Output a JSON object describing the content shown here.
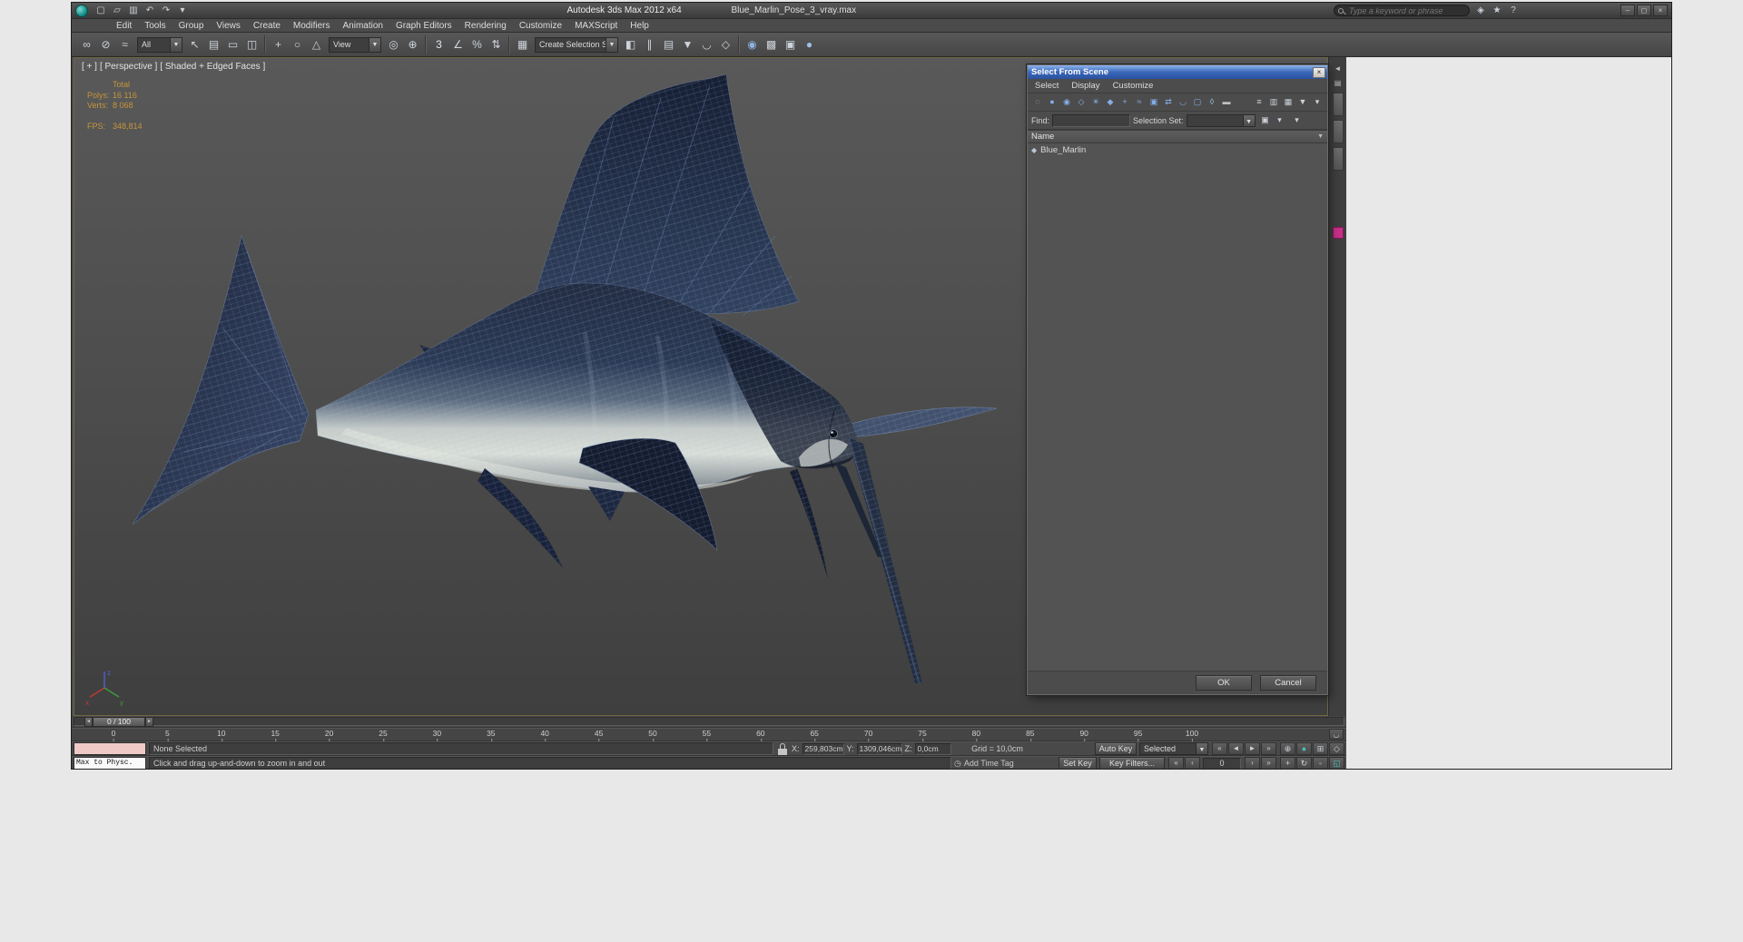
{
  "colors": {
    "accent_teal": "#45c0b5",
    "stats_amber": "#c6953b",
    "dialog_title_blue": "#3a67b8",
    "listener_pink": "#efc9c6",
    "magenta_chip": "#ca2f88",
    "marlin_navy": "#222c42",
    "marlin_belly": "#dadfd9"
  },
  "window": {
    "app_title": "Autodesk 3ds Max 2012 x64",
    "doc_title": "Blue_Marlin_Pose_3_vray.max",
    "search_placeholder": "Type a keyword or phrase",
    "quick_access": [
      {
        "name": "new-scene-icon",
        "glyph": "▢"
      },
      {
        "name": "open-file-icon",
        "glyph": "▱"
      },
      {
        "name": "save-file-icon",
        "glyph": "▥"
      },
      {
        "name": "undo-icon",
        "glyph": "↶"
      },
      {
        "name": "redo-icon",
        "glyph": "↷"
      },
      {
        "name": "project-folder-icon",
        "glyph": "▾"
      }
    ],
    "title_right_icons": [
      {
        "name": "communication-center-icon",
        "glyph": "◈"
      },
      {
        "name": "favorites-icon",
        "glyph": "★"
      },
      {
        "name": "help-icon",
        "glyph": "?"
      }
    ],
    "window_controls": [
      {
        "name": "minimize-button",
        "glyph": "–"
      },
      {
        "name": "restore-button",
        "glyph": "◻"
      },
      {
        "name": "close-button",
        "glyph": "×"
      }
    ]
  },
  "menus": [
    "Edit",
    "Tools",
    "Group",
    "Views",
    "Create",
    "Modifiers",
    "Animation",
    "Graph Editors",
    "Rendering",
    "Customize",
    "MAXScript",
    "Help"
  ],
  "toolbar": {
    "filter_value": "All",
    "coord_value": "View",
    "selection_set_value": "Create Selection Set",
    "group1": [
      {
        "name": "select-and-link-icon",
        "glyph": "∞"
      },
      {
        "name": "unlink-selection-icon",
        "glyph": "⊘"
      },
      {
        "name": "bind-to-space-warp-icon",
        "glyph": "≈"
      }
    ],
    "group2": [
      {
        "name": "select-object-icon",
        "glyph": "↖"
      },
      {
        "name": "select-by-name-icon",
        "glyph": "▤"
      },
      {
        "name": "rectangular-selection-region-icon",
        "glyph": "▭"
      },
      {
        "name": "window-crossing-icon",
        "glyph": "◫"
      },
      {
        "sep": true
      },
      {
        "name": "select-and-move-icon",
        "glyph": "+"
      },
      {
        "name": "select-and-rotate-icon",
        "glyph": "○"
      },
      {
        "name": "select-and-scale-icon",
        "glyph": "△"
      }
    ],
    "group3": [
      {
        "name": "use-pivot-point-center-icon",
        "glyph": "◎"
      },
      {
        "name": "select-and-manipulate-icon",
        "glyph": "⊕"
      },
      {
        "sep": true
      },
      {
        "name": "snaps-toggle-icon",
        "glyph": "3",
        "color": "#e2e8ef"
      },
      {
        "name": "angle-snap-icon",
        "glyph": "∠"
      },
      {
        "name": "percent-snap-icon",
        "glyph": "%"
      },
      {
        "name": "spinner-snap-icon",
        "glyph": "⇅"
      },
      {
        "sep": true
      },
      {
        "name": "edit-named-selection-sets-icon",
        "glyph": "▦"
      }
    ],
    "group4": [
      {
        "name": "mirror-icon",
        "glyph": "◧"
      },
      {
        "name": "align-icon",
        "glyph": "∥"
      },
      {
        "name": "layer-manager-icon",
        "glyph": "▤"
      },
      {
        "name": "graphite-modeling-icon",
        "glyph": "▼"
      },
      {
        "name": "curve-editor-icon",
        "glyph": "◡"
      },
      {
        "name": "schematic-view-icon",
        "glyph": "◇"
      },
      {
        "sep": true
      },
      {
        "name": "material-editor-icon",
        "glyph": "◉",
        "color": "#8fb4e2"
      },
      {
        "name": "render-setup-icon",
        "glyph": "▩"
      },
      {
        "name": "rendered-frame-window-icon",
        "glyph": "▣"
      },
      {
        "name": "render-production-icon",
        "glyph": "●",
        "color": "#9fc0e8"
      }
    ]
  },
  "viewport": {
    "label_general": "[ + ]",
    "label_pov": "[ Perspective ]",
    "label_shading": "[ Shaded + Edged Faces ]",
    "stats": {
      "total_label": "Total",
      "polys_label": "Polys:",
      "polys_value": "16 116",
      "verts_label": "Verts:",
      "verts_value": "8 068",
      "fps_label": "FPS:",
      "fps_value": "348,814"
    },
    "axis": {
      "x": "x",
      "y": "y",
      "z": "z"
    },
    "object_name": "Blue_Marlin"
  },
  "side_strip": {
    "icons": [
      {
        "name": "command-panel-arrow-icon",
        "glyph": "◄"
      },
      {
        "name": "command-panel-tab-icon",
        "glyph": "▤"
      }
    ]
  },
  "scene_dialog": {
    "title": "Select From Scene",
    "menus": [
      "Select",
      "Display",
      "Customize"
    ],
    "toolbar_icons": [
      {
        "name": "display-none-icon",
        "glyph": "◌",
        "color": "#cfcfcf"
      },
      {
        "name": "display-all-icon",
        "glyph": "●",
        "color": "#85aee8"
      },
      {
        "name": "display-geometry-icon",
        "glyph": "◉",
        "color": "#85aee8"
      },
      {
        "name": "display-shapes-icon",
        "glyph": "◇",
        "color": "#85aee8"
      },
      {
        "name": "display-lights-icon",
        "glyph": "☀",
        "color": "#85aee8"
      },
      {
        "name": "display-cameras-icon",
        "glyph": "◆",
        "color": "#85aee8"
      },
      {
        "name": "display-helpers-icon",
        "glyph": "+",
        "color": "#85aee8"
      },
      {
        "name": "display-space-warps-icon",
        "glyph": "≈",
        "color": "#85aee8"
      },
      {
        "name": "display-groups-icon",
        "glyph": "▣",
        "color": "#85aee8"
      },
      {
        "name": "display-xrefs-icon",
        "glyph": "⇄",
        "color": "#85aee8"
      },
      {
        "name": "display-bones-icon",
        "glyph": "◡",
        "color": "#85aee8"
      },
      {
        "name": "display-containers-icon",
        "glyph": "▢",
        "color": "#85aee8"
      },
      {
        "name": "display-frozen-icon",
        "glyph": "◊",
        "color": "#9fd0e8"
      },
      {
        "name": "display-hidden-icon",
        "glyph": "▬",
        "color": "#c0c0c0"
      }
    ],
    "view_icons": [
      {
        "name": "display-mode-list-icon",
        "glyph": "≡"
      },
      {
        "name": "display-mode-detail-icon",
        "glyph": "▥"
      },
      {
        "name": "display-mode-columns-icon",
        "glyph": "▦"
      },
      {
        "name": "filter-selection-icon",
        "glyph": "▼"
      },
      {
        "name": "dialog-options-icon",
        "glyph": "▾"
      }
    ],
    "find_label": "Find:",
    "find_value": "",
    "selection_set_label": "Selection Set:",
    "selection_set_value": "",
    "set_buttons": [
      {
        "name": "save-selection-set-icon",
        "glyph": "▣"
      },
      {
        "name": "selection-set-menu-icon",
        "glyph": "▾"
      }
    ],
    "name_header": "Name",
    "rows": [
      {
        "icon_glyph": "◆",
        "label": "Blue_Marlin"
      }
    ],
    "ok_label": "OK",
    "cancel_label": "Cancel"
  },
  "timeline": {
    "slider_value": "0 / 100",
    "ticks": [
      "0",
      "5",
      "10",
      "15",
      "20",
      "25",
      "30",
      "35",
      "40",
      "45",
      "50",
      "55",
      "60",
      "65",
      "70",
      "75",
      "80",
      "85",
      "90",
      "95",
      "100"
    ]
  },
  "status": {
    "maxscript_text": "Max to Physc.",
    "selection_text": "None Selected",
    "coords": {
      "x_label": "X:",
      "x_value": "259,803cm",
      "y_label": "Y:",
      "y_value": "1309,046cm",
      "z_label": "Z:",
      "z_value": "0,0cm"
    },
    "grid_text": "Grid = 10,0cm",
    "prompt_text": "Click and drag up-and-down to zoom in and out",
    "time_tag_text": "Add Time Tag",
    "auto_key_label": "Auto Key",
    "set_key_label": "Set Key",
    "selected_value": "Selected",
    "key_filters_label": "Key Filters...",
    "frame_value": "0",
    "playback1": [
      {
        "name": "go-to-start-button",
        "glyph": "«"
      },
      {
        "name": "previous-key-button",
        "glyph": "◄"
      },
      {
        "name": "play-animation-button",
        "glyph": "►"
      },
      {
        "name": "go-to-end-button",
        "glyph": "»"
      }
    ],
    "playback2_left": [
      {
        "name": "go-to-start-frame-button",
        "glyph": "«"
      },
      {
        "name": "previous-frame-button",
        "glyph": "‹"
      }
    ],
    "playback2_right": [
      {
        "name": "next-frame-button",
        "glyph": "›"
      },
      {
        "name": "go-to-end-frame-button",
        "glyph": "»"
      }
    ],
    "nav1": [
      {
        "name": "zoom-icon",
        "glyph": "⊕"
      },
      {
        "name": "zoom-extents-icon",
        "glyph": "●",
        "accent": true
      },
      {
        "name": "zoom-region-icon",
        "glyph": "⊞"
      },
      {
        "name": "field-of-view-icon",
        "glyph": "◇"
      }
    ],
    "nav2": [
      {
        "name": "pan-icon",
        "glyph": "+"
      },
      {
        "name": "orbit-icon",
        "glyph": "↻"
      },
      {
        "name": "walk-through-icon",
        "glyph": "◦"
      },
      {
        "name": "maximize-viewport-icon",
        "glyph": "◱",
        "accent": true
      }
    ]
  }
}
